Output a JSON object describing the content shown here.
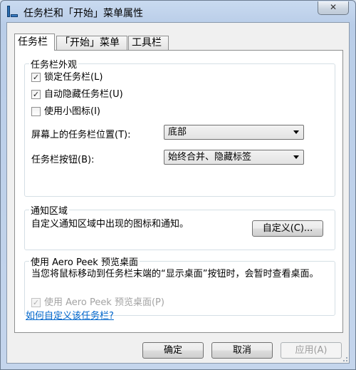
{
  "window": {
    "title": "任务栏和「开始」菜单属性",
    "close_label": "✕"
  },
  "tabs": [
    {
      "label": "任务栏",
      "active": true
    },
    {
      "label": "「开始」菜单",
      "active": false
    },
    {
      "label": "工具栏",
      "active": false
    }
  ],
  "appearance": {
    "legend": "任务栏外观",
    "lock": {
      "label": "锁定任务栏(L)",
      "checked": true
    },
    "autohide": {
      "label": "自动隐藏任务栏(U)",
      "checked": true
    },
    "small_icons": {
      "label": "使用小图标(I)",
      "checked": false
    },
    "location_label": "屏幕上的任务栏位置(T):",
    "location_value": "底部",
    "buttons_label": "任务栏按钮(B):",
    "buttons_value": "始终合并、隐藏标签"
  },
  "notification": {
    "legend": "通知区域",
    "description": "自定义通知区域中出现的图标和通知。",
    "customize_label": "自定义(C)..."
  },
  "peek": {
    "legend": "使用 Aero Peek 预览桌面",
    "description": "当您将鼠标移动到任务栏末端的“显示桌面”按钮时，会暂时查看桌面。",
    "checkbox": {
      "label": "使用 Aero Peek 预览桌面(P)",
      "checked": true,
      "disabled": true
    }
  },
  "help_link": "如何自定义该任务栏?",
  "footer": {
    "ok_label": "确定",
    "cancel_label": "取消",
    "apply_label": "应用(A)"
  },
  "icons": {
    "check": "✓",
    "close": "close-icon",
    "dropdown": "chevron-down-icon",
    "app": "taskbar-icon"
  }
}
